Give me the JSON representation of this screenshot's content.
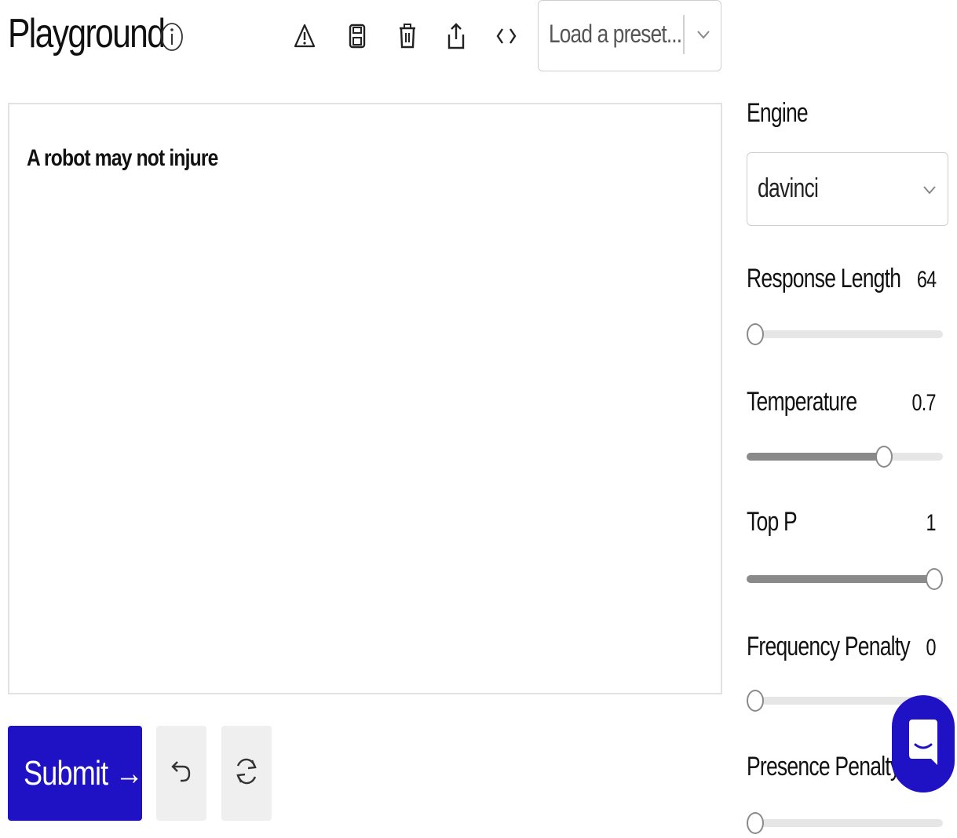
{
  "header": {
    "title": "Playground",
    "icons": [
      "info-icon",
      "warning-icon",
      "save-icon",
      "trash-icon",
      "share-icon",
      "code-icon"
    ],
    "preset_placeholder": "Load a preset..."
  },
  "prompt": {
    "text": "A robot may not injure"
  },
  "actions": {
    "submit_label": "Submit →",
    "undo_icon": "undo-icon",
    "regenerate_icon": "refresh-icon"
  },
  "settings": {
    "engine_label": "Engine",
    "engine_value": "davinci",
    "sliders": [
      {
        "label": "Response Length",
        "value": "64",
        "level": 0.0
      },
      {
        "label": "Temperature",
        "value": "0.7",
        "level": 0.7
      },
      {
        "label": "Top P",
        "value": "1",
        "level": 1.0
      },
      {
        "label": "Frequency Penalty",
        "value": "0",
        "level": 0.0
      },
      {
        "label": "Presence Penalty",
        "value": "",
        "level": 0.0
      }
    ]
  },
  "chat_widget": {
    "icon": "chat-icon",
    "color": "#1e12c4"
  },
  "colors": {
    "accent": "#1e12c4",
    "slider_fill": "#8a8a8a",
    "slider_track": "#e6e6e6"
  }
}
